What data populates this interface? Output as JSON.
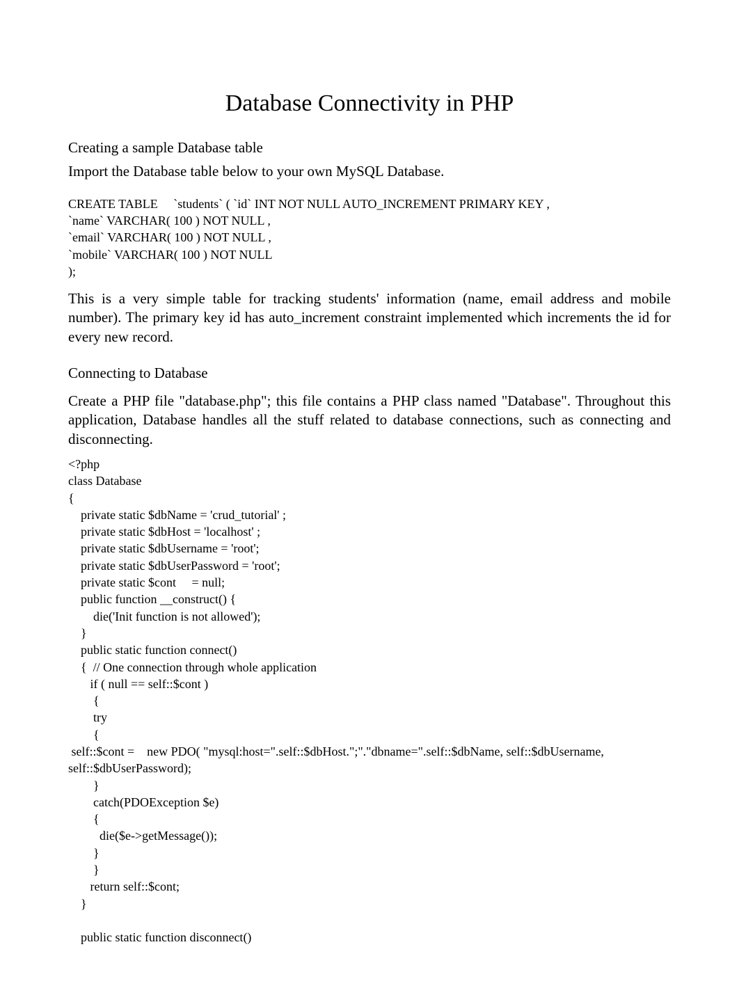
{
  "title": "Database Connectivity in PHP",
  "section1": {
    "heading": "Creating a sample Database table",
    "intro": "Import the Database table below to your own MySQL Database.",
    "code": "CREATE TABLE     `students` ( `id` INT NOT NULL AUTO_INCREMENT PRIMARY KEY ,\n`name` VARCHAR( 100 ) NOT NULL ,\n`email` VARCHAR( 100 ) NOT NULL ,\n`mobile` VARCHAR( 100 ) NOT NULL\n);",
    "description": "This is a very simple table for tracking students' information (name, email address and mobile number). The primary key id has auto_increment constraint implemented which increments the id for every new record."
  },
  "section2": {
    "heading": "Connecting to Database",
    "intro": "Create a PHP file \"database.php\"; this file contains a PHP class named \"Database\". Throughout this application, Database handles all the stuff related to database connections, such as connecting and disconnecting.",
    "code": "<?php\nclass Database\n{\n    private static $dbName = 'crud_tutorial' ;\n    private static $dbHost = 'localhost' ;\n    private static $dbUsername = 'root';\n    private static $dbUserPassword = 'root';\n    private static $cont     = null;\n    public function __construct() {\n        die('Init function is not allowed');\n    }\n    public static function connect()\n    {  // One connection through whole application\n       if ( null == self::$cont )\n        {\n        try\n        {\n self::$cont =    new PDO( \"mysql:host=\".self::$dbHost.\";\".\"dbname=\".self::$dbName, self::$dbUsername,\nself::$dbUserPassword);\n        }\n        catch(PDOException $e)\n        {\n          die($e->getMessage());\n        }\n        }\n       return self::$cont;\n    }\n\n    public static function disconnect()"
  }
}
